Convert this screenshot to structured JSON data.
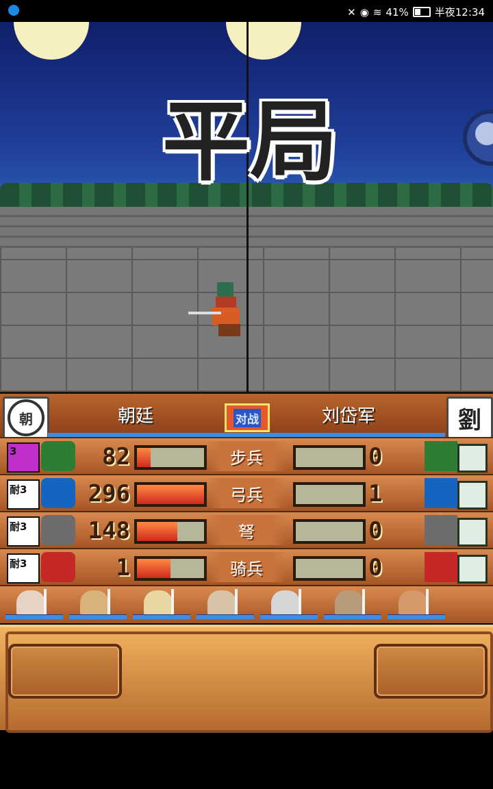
{
  "status": {
    "battery": "41%",
    "time": "半夜12:34"
  },
  "battle": {
    "result": "平局"
  },
  "header": {
    "left_team": "朝廷",
    "right_team": "刘岱军",
    "vs_label": "对战",
    "left_crest": "朝",
    "right_crest": "劉"
  },
  "rows": [
    {
      "rank": "3",
      "value": "82",
      "type": "步兵",
      "enemy": "0",
      "fill": 0.2,
      "enemy_fill": 0,
      "color": "#2e7d32"
    },
    {
      "rank": "耐3",
      "value": "296",
      "type": "弓兵",
      "enemy": "1",
      "fill": 1.0,
      "enemy_fill": 0,
      "color": "#1565c0"
    },
    {
      "rank": "耐3",
      "value": "148",
      "type": "弩",
      "enemy": "0",
      "fill": 0.6,
      "enemy_fill": 0,
      "color": "#6d6d6d"
    },
    {
      "rank": "耐3",
      "value": "1",
      "type": "骑兵",
      "enemy": "0",
      "fill": 0.5,
      "enemy_fill": 0,
      "color": "#c62828"
    }
  ],
  "portraits": [
    {
      "name": "portrait-1",
      "color": "#e7d3c3"
    },
    {
      "name": "portrait-2",
      "color": "#d9b27c"
    },
    {
      "name": "portrait-3",
      "color": "#e8d7a2"
    },
    {
      "name": "portrait-4",
      "color": "#d6c3a8"
    },
    {
      "name": "portrait-5",
      "color": "#d6d6d6"
    },
    {
      "name": "portrait-6",
      "color": "#b99b7a"
    },
    {
      "name": "portrait-7",
      "color": "#d59a6c"
    }
  ]
}
